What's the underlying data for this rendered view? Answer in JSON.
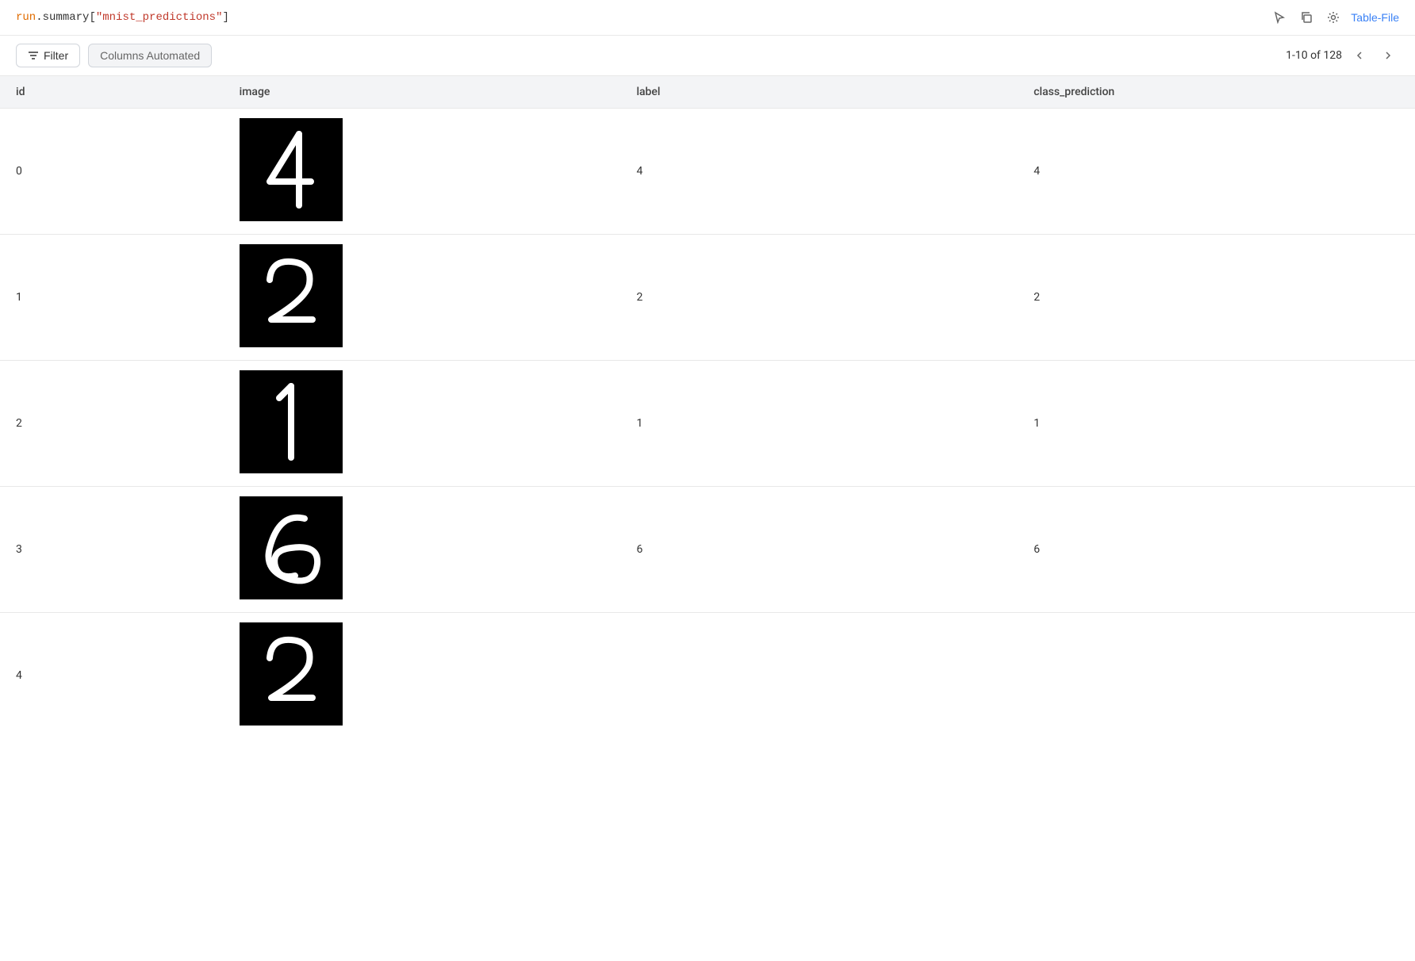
{
  "header": {
    "code": {
      "obj": "run",
      "accessor": ".summary",
      "key": "\"mnist_predictions\""
    },
    "actions": {
      "cursor_icon": "cursor-icon",
      "copy_icon": "copy-icon",
      "gear_icon": "gear-icon",
      "table_file_label": "Table-File"
    }
  },
  "toolbar": {
    "filter_label": "Filter",
    "columns_label": "Columns Automated",
    "pagination": {
      "range": "1-10 of 128"
    }
  },
  "table": {
    "columns": [
      {
        "key": "id",
        "label": "id"
      },
      {
        "key": "image",
        "label": "image"
      },
      {
        "key": "label",
        "label": "label"
      },
      {
        "key": "class_prediction",
        "label": "class_prediction"
      }
    ],
    "rows": [
      {
        "id": "0",
        "label": "4",
        "class_prediction": "4",
        "digit": "4"
      },
      {
        "id": "1",
        "label": "2",
        "class_prediction": "2",
        "digit": "2"
      },
      {
        "id": "2",
        "label": "1",
        "class_prediction": "1",
        "digit": "1"
      },
      {
        "id": "3",
        "label": "6",
        "class_prediction": "6",
        "digit": "6"
      },
      {
        "id": "4",
        "label": "",
        "class_prediction": "",
        "digit": "2"
      }
    ]
  },
  "colors": {
    "accent": "#3b82f6",
    "code_obj": "#e06c00",
    "code_key": "#c0392b",
    "header_bg": "#f3f4f6",
    "border": "#e8e8e8"
  }
}
